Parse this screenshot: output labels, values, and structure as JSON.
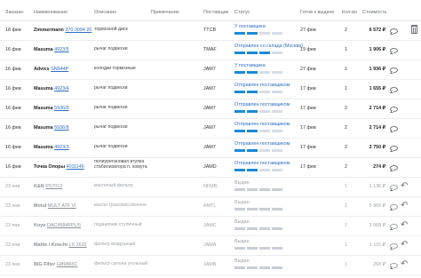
{
  "header": {
    "ordered": "Заказан",
    "name": "Наименование",
    "description": "Описание",
    "note": "Примечание",
    "supplier": "Поставщик",
    "status": "Статус",
    "ready": "Готов к выдаче",
    "qty": "Кол-во",
    "cost": "Стоимость"
  },
  "rows": [
    {
      "date": "18 фев",
      "brand": "Zimmermann",
      "num": "370 3094 20",
      "desc": "тормозной диск",
      "supplier": "TTCB",
      "status": "У поставщика",
      "progress": 2,
      "ready": "27 фев",
      "qty": "2",
      "cost": "6 572 ₽",
      "muted": false
    },
    {
      "date": "16 фев",
      "brand": "Masuma",
      "num": "4923/5",
      "desc": "рычаг подвески",
      "supplier": "TMAF",
      "status": "Отправлен со склада (Москва)",
      "progress": 3,
      "ready": "19 фев",
      "qty": "1",
      "cost": "1 906 ₽",
      "muted": false
    },
    {
      "date": "16 фев",
      "brand": "Advics",
      "num": "SN944P",
      "desc": "колодки тормозные",
      "supplier": "JAM7",
      "status": "У поставщика",
      "progress": 2,
      "ready": "27 фев",
      "qty": "1",
      "cost": "1 936 ₽",
      "muted": false
    },
    {
      "date": "16 фев",
      "brand": "Masuma",
      "num": "4923/4",
      "desc": "рычаг подвески",
      "supplier": "JAM7",
      "status": "Отправлен поставщиком",
      "progress": 2,
      "ready": "17 фев",
      "qty": "1",
      "cost": "1 655 ₽",
      "muted": false
    },
    {
      "date": "16 фев",
      "brand": "Masuma",
      "num": "5936/9",
      "desc": "рычаг подвески",
      "supplier": "JAM7",
      "status": "Отправлен поставщиком",
      "progress": 2,
      "ready": "17 фев",
      "qty": "2",
      "cost": "2 714 ₽",
      "muted": false
    },
    {
      "date": "16 фев",
      "brand": "Masuma",
      "num": "5936/8",
      "desc": "рычаг подвески",
      "supplier": "JAM7",
      "status": "Отправлен поставщиком",
      "progress": 2,
      "ready": "17 фев",
      "qty": "2",
      "cost": "2 714 ₽",
      "muted": false
    },
    {
      "date": "16 фев",
      "brand": "Masuma",
      "num": "4923/3",
      "desc": "рычаг подвески",
      "supplier": "JAM7",
      "status": "Отправлен поставщиком",
      "progress": 2,
      "ready": "17 фев",
      "qty": "2",
      "cost": "3 750 ₽",
      "muted": false
    },
    {
      "date": "16 фев",
      "brand": "Точка Опоры",
      "num": "4011146",
      "desc": "полиуретановая втулка стабилизатора п. хомута",
      "supplier": "JAMD",
      "status": "Отправлен поставщиком",
      "progress": 2,
      "ready": "17 фев",
      "qty": "2",
      "cost": "274 ₽",
      "muted": false
    },
    {
      "date": "23 янв",
      "brand": "K&N",
      "num": "PS7013",
      "desc": "масляный фильтр",
      "supplier": "NFMB",
      "status": "Выдан",
      "progress": 4,
      "ready": "",
      "qty": "1",
      "cost": "1 136 ₽",
      "muted": true
    },
    {
      "date": "23 янв",
      "brand": "Motul",
      "num": "MULT ATF VI",
      "desc": "масло трансмиссионное",
      "supplier": "AMTL",
      "status": "Выдан",
      "progress": 4,
      "ready": "",
      "qty": "1",
      "cost": "5 966 ₽",
      "muted": true
    },
    {
      "date": "23 янв",
      "brand": "Koyo",
      "num": "DAC4584PPL/5",
      "desc": "подшипник ступичный",
      "supplier": "JAMC",
      "status": "Выдан",
      "progress": 4,
      "ready": "",
      "qty": "1",
      "cost": "2 068 ₽",
      "muted": true
    },
    {
      "date": "23 янв",
      "brand": "Mahle / Knecht",
      "num": "LX 2632",
      "desc": "фильтр воздушный",
      "supplier": "JAMA",
      "status": "Выдан",
      "progress": 4,
      "ready": "",
      "qty": "1",
      "cost": "1 115 ₽",
      "muted": true
    },
    {
      "date": "23 янв",
      "brand": "BIG Filter",
      "num": "GB9865C",
      "desc": "фильтр салона угольный",
      "supplier": "JAMB",
      "status": "Выдан",
      "progress": 4,
      "ready": "",
      "qty": "1",
      "cost": "268 ₽",
      "muted": true
    }
  ]
}
